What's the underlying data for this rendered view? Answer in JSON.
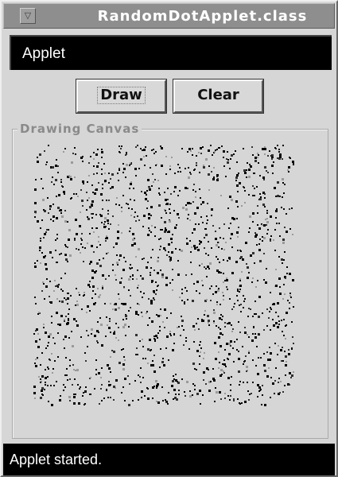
{
  "window": {
    "title": "RandomDotApplet.class",
    "menu_icon": "window-menu-icon"
  },
  "applet": {
    "label": "Applet"
  },
  "toolbar": {
    "draw_label": "Draw",
    "clear_label": "Clear"
  },
  "canvas": {
    "legend": "Drawing Canvas",
    "dot_count": 1600,
    "dot_colors": [
      "#000000",
      "#303030",
      "#9a9a9a"
    ]
  },
  "status": {
    "text": "Applet started."
  }
}
